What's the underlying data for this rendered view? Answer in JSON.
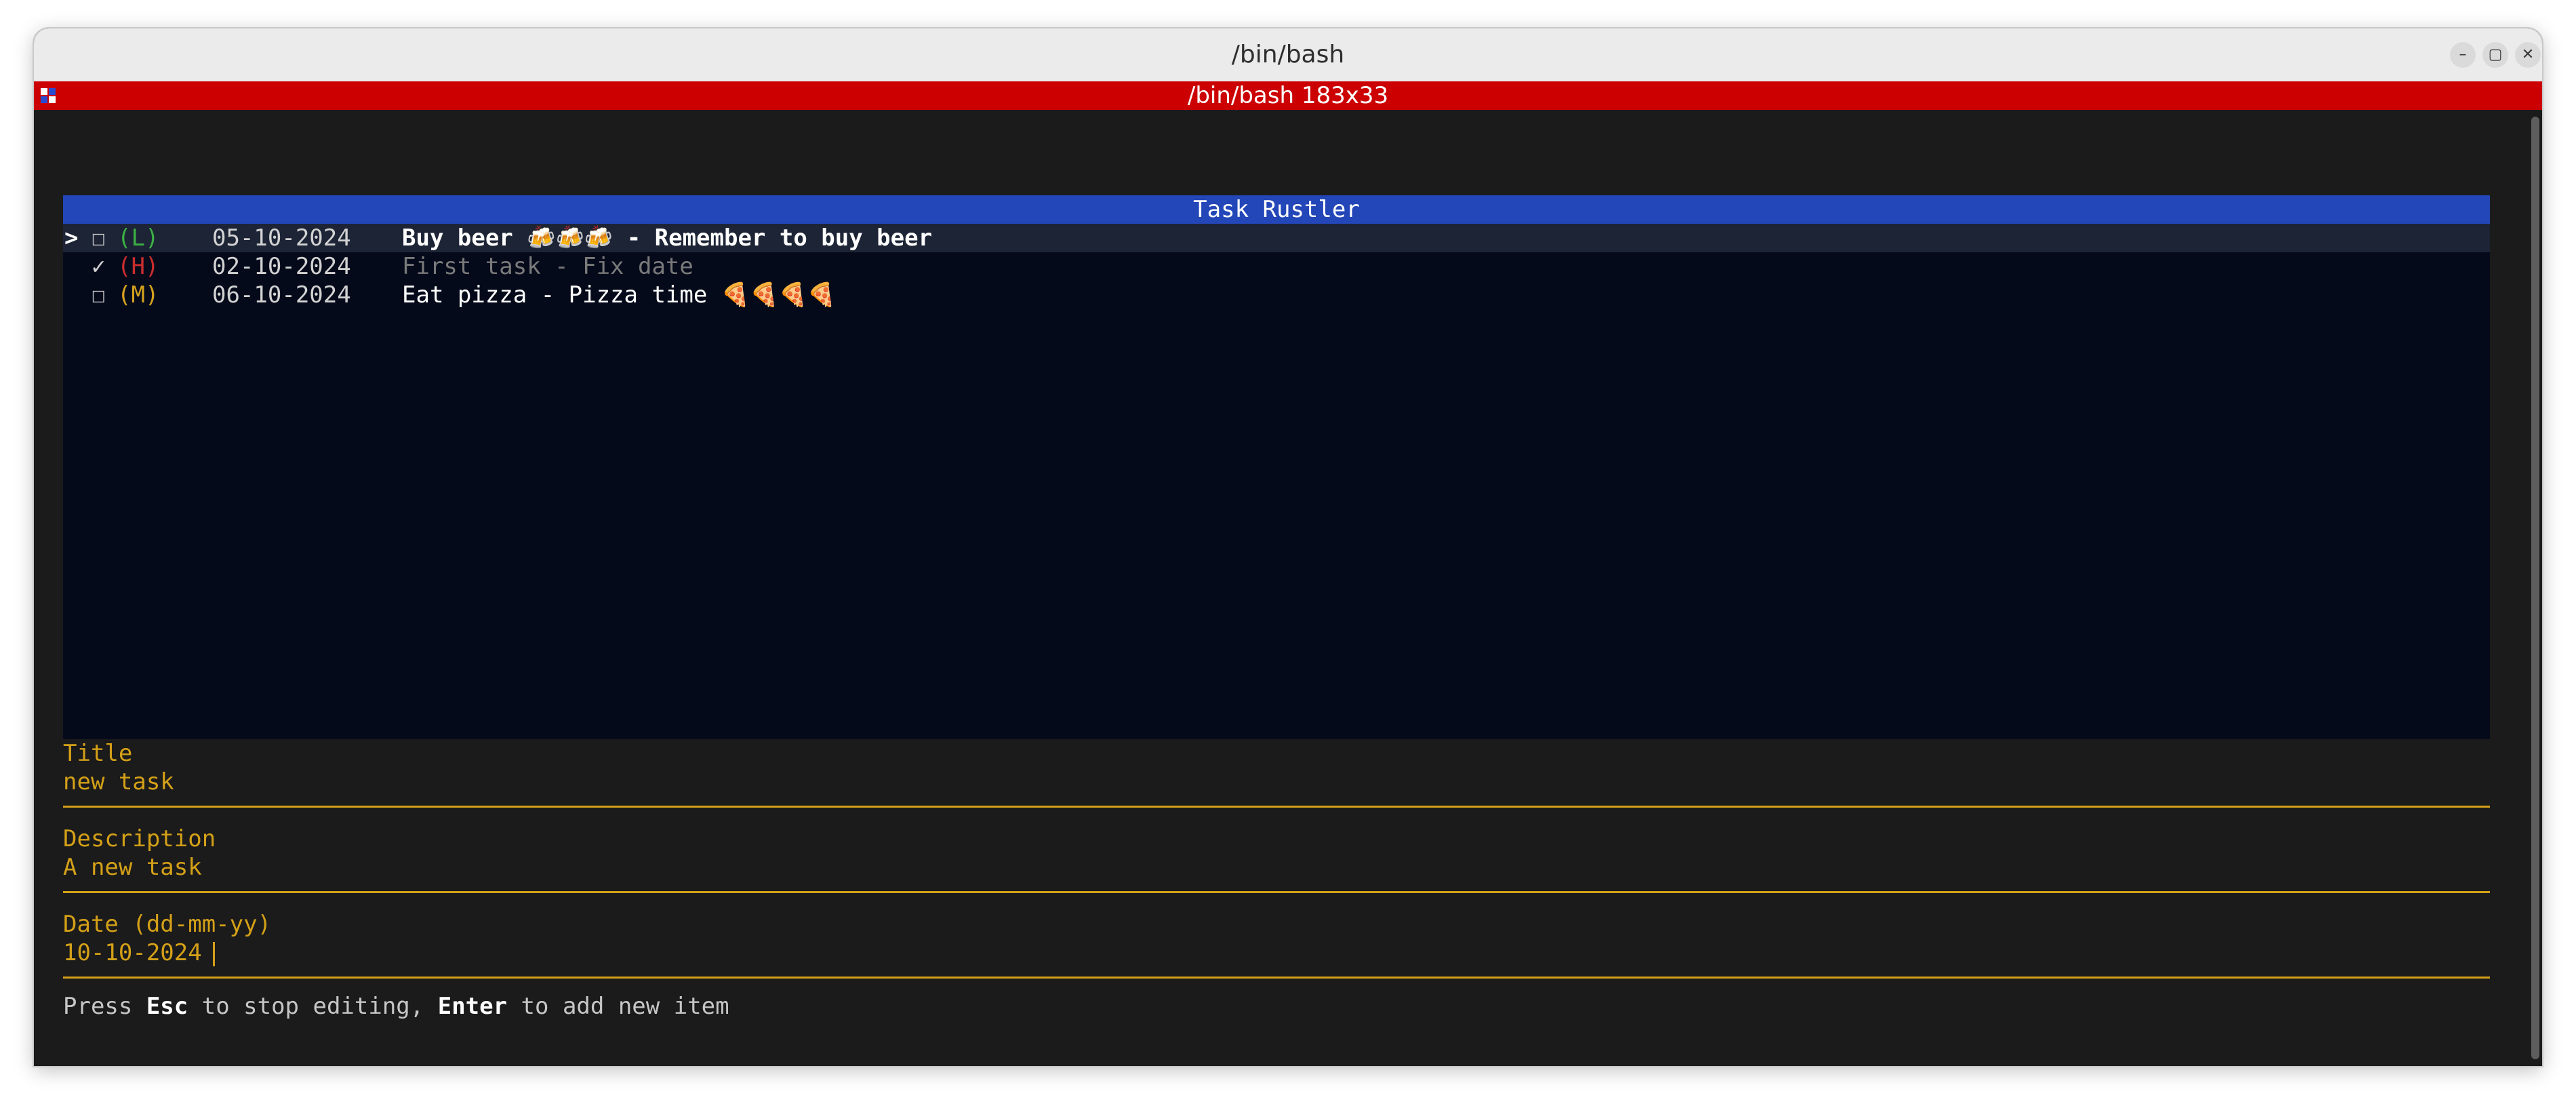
{
  "window": {
    "title": "/bin/bash",
    "buttons": {
      "minimize": "–",
      "maximize": "▢",
      "close": "✕"
    }
  },
  "status_bar": {
    "title": "/bin/bash 183x33",
    "color": "#cc0000"
  },
  "app": {
    "header": "Task Rustler",
    "tasks": [
      {
        "cursor": ">",
        "check": "☐",
        "priority": "(L)",
        "date": "05-10-2024",
        "text": "Buy beer 🍻🍻🍻 - Remember to buy beer",
        "selected": true,
        "done": false
      },
      {
        "cursor": "",
        "check": "✓",
        "priority": "(H)",
        "date": "02-10-2024",
        "text": "First task - Fix date",
        "selected": false,
        "done": true
      },
      {
        "cursor": "",
        "check": "☐",
        "priority": "(M)",
        "date": "06-10-2024",
        "text": "Eat pizza - Pizza time 🍕🍕🍕🍕",
        "selected": false,
        "done": false
      }
    ],
    "form": {
      "title_label": "Title",
      "title_value": "new task",
      "description_label": "Description",
      "description_value": "A new task",
      "date_label": "Date (dd-mm-yy)",
      "date_value": "10-10-2024"
    },
    "help": {
      "press": "Press ",
      "esc_key": "Esc",
      "esc_text": " to stop editing, ",
      "enter_key": "Enter",
      "enter_text": " to add new item"
    }
  },
  "colors": {
    "header": "#2346b8",
    "list_bg": "#050a1b",
    "accent": "#d4a017",
    "prio_low": "#3cb043",
    "prio_high": "#cc2d2d",
    "prio_medium": "#d6a21e"
  }
}
